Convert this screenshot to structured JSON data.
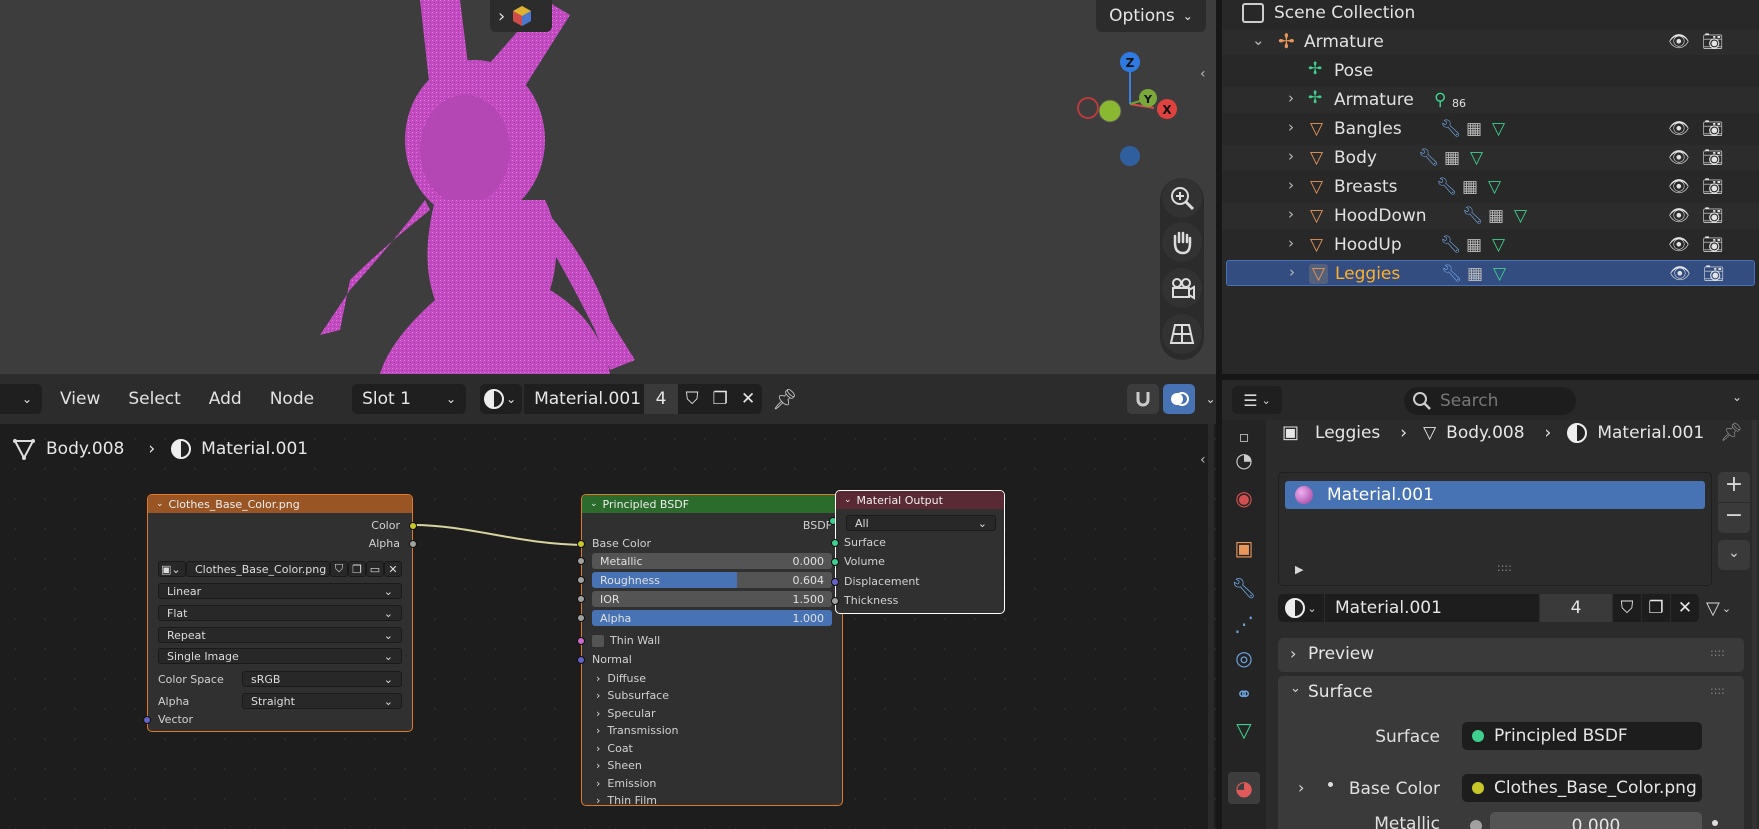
{
  "viewport": {
    "options_label": "Options",
    "gizmo": {
      "z": "Z",
      "y": "Y",
      "x": "X"
    }
  },
  "node_editor": {
    "menus": [
      "View",
      "Select",
      "Add",
      "Node"
    ],
    "slot": "Slot 1",
    "material_name": "Material.001",
    "user_count": "4",
    "breadcrumb": {
      "object": "Body.008",
      "material": "Material.001"
    },
    "image_node": {
      "title": "Clothes_Base_Color.png",
      "out_color": "Color",
      "out_alpha": "Alpha",
      "image_name": "Clothes_Base_Color.png",
      "interpolation": "Linear",
      "projection": "Flat",
      "extension": "Repeat",
      "source": "Single Image",
      "color_space_label": "Color Space",
      "color_space": "sRGB",
      "alpha_label": "Alpha",
      "alpha_mode": "Straight",
      "vector_label": "Vector"
    },
    "bsdf_node": {
      "title": "Principled BSDF",
      "out_bsdf": "BSDF",
      "base_color": "Base Color",
      "metallic": {
        "label": "Metallic",
        "value": "0.000"
      },
      "roughness": {
        "label": "Roughness",
        "value": "0.604",
        "fraction": 0.604
      },
      "ior": {
        "label": "IOR",
        "value": "1.500"
      },
      "alpha": {
        "label": "Alpha",
        "value": "1.000"
      },
      "thin_wall": "Thin Wall",
      "normal": "Normal",
      "sections": [
        "Diffuse",
        "Subsurface",
        "Specular",
        "Transmission",
        "Coat",
        "Sheen",
        "Emission",
        "Thin Film"
      ]
    },
    "output_node": {
      "title": "Material Output",
      "target": "All",
      "inputs": [
        "Surface",
        "Volume",
        "Displacement",
        "Thickness"
      ]
    }
  },
  "outliner": {
    "root": "Scene Collection",
    "items": [
      {
        "name": "Armature",
        "level": 0
      },
      {
        "name": "Pose",
        "level": 1
      },
      {
        "name": "Armature",
        "level": 1,
        "badge": "86"
      },
      {
        "name": "Bangles",
        "level": 1
      },
      {
        "name": "Body",
        "level": 1
      },
      {
        "name": "Breasts",
        "level": 1
      },
      {
        "name": "HoodDown",
        "level": 1
      },
      {
        "name": "HoodUp",
        "level": 1
      },
      {
        "name": "Leggies",
        "level": 1,
        "selected": true
      }
    ]
  },
  "properties": {
    "search_placeholder": "Search",
    "breadcrumb": {
      "object": "Leggies",
      "mesh": "Body.008",
      "material": "Material.001"
    },
    "slot_item": "Material.001",
    "material_name": "Material.001",
    "user_count": "4",
    "preview_label": "Preview",
    "surface_label": "Surface",
    "surface_field_label": "Surface",
    "surface_value": "Principled BSDF",
    "base_color_label": "Base Color",
    "base_color_value": "Clothes_Base_Color.png",
    "metallic_label": "Metallic",
    "metallic_value": "0.000"
  },
  "colors": {
    "accent": "#4772b3",
    "selected_text": "#ffaf29",
    "mesh_orange": "#e8965a",
    "wrench_blue": "#6ea4e0",
    "green": "#3fcf8e"
  }
}
